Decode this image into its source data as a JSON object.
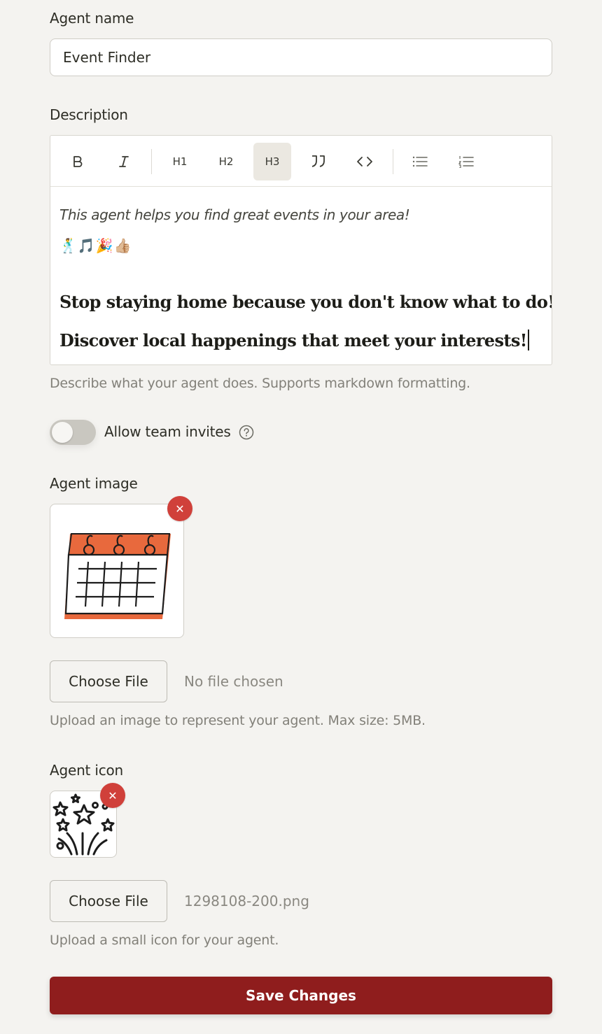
{
  "agent_name": {
    "label": "Agent name",
    "value": "Event Finder"
  },
  "description": {
    "label": "Description",
    "toolbar": {
      "bold": "B",
      "italic": "I",
      "h1": "H1",
      "h2": "H2",
      "h3": "H3",
      "active": "h3"
    },
    "content": {
      "italic_line": "This agent helps you find great events in your area!",
      "emoji_line": "🕺🎵🎉👍🏼",
      "heading1": "Stop staying home because you don't know what to do!",
      "heading2": "Discover local happenings that meet your interests!"
    },
    "help": "Describe what your agent does. Supports markdown formatting."
  },
  "team_invites": {
    "label": "Allow team invites",
    "enabled": false
  },
  "agent_image": {
    "label": "Agent image",
    "icon": "calendar-icon",
    "choose_label": "Choose File",
    "file_status": "No file chosen",
    "help": "Upload an image to represent your agent. Max size: 5MB."
  },
  "agent_icon": {
    "label": "Agent icon",
    "icon": "fireworks-icon",
    "choose_label": "Choose File",
    "file_status": "1298108-200.png",
    "help": "Upload a small icon for your agent."
  },
  "save_label": "Save Changes",
  "colors": {
    "accent": "#8f1d1d",
    "remove": "#d0403a",
    "calendar_orange": "#e8693d"
  }
}
